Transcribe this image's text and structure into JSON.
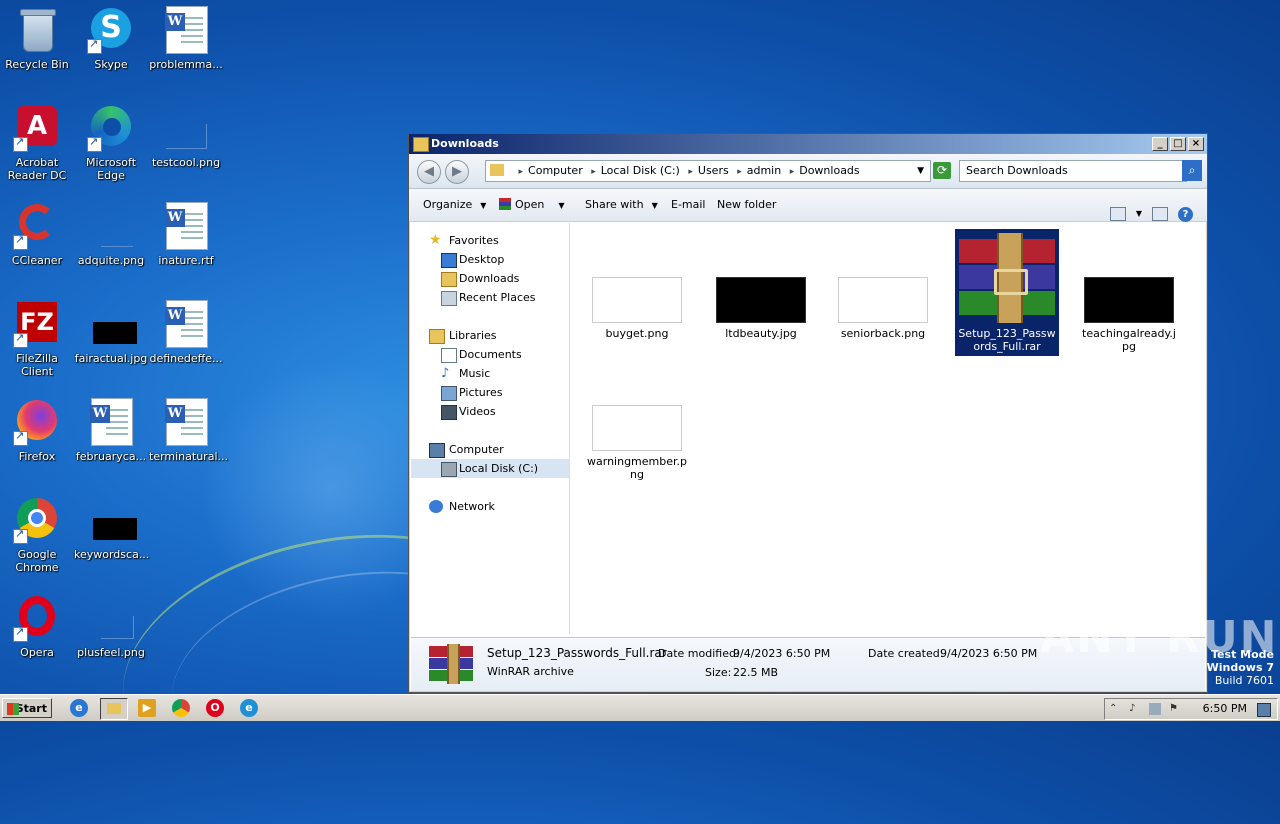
{
  "desktop": {
    "icons": [
      {
        "label": "Recycle Bin"
      },
      {
        "label": "Skype"
      },
      {
        "label": "problemma..."
      },
      {
        "label": "Acrobat Reader DC"
      },
      {
        "label": "Microsoft Edge"
      },
      {
        "label": "testcool.png"
      },
      {
        "label": "CCleaner"
      },
      {
        "label": "adquite.png"
      },
      {
        "label": "inature.rtf"
      },
      {
        "label": "FileZilla Client"
      },
      {
        "label": "fairactual.jpg"
      },
      {
        "label": "definedeffe..."
      },
      {
        "label": "Firefox"
      },
      {
        "label": "februaryca..."
      },
      {
        "label": "terminatural..."
      },
      {
        "label": "Google Chrome"
      },
      {
        "label": "keywordsca..."
      },
      {
        "label": "Opera"
      },
      {
        "label": "plusfeel.png"
      }
    ]
  },
  "window": {
    "title": "Downloads",
    "breadcrumb": [
      "Computer",
      "Local Disk (C:)",
      "Users",
      "admin",
      "Downloads"
    ],
    "search_placeholder": "Search Downloads",
    "toolbar": {
      "organize": "Organize",
      "open": "Open",
      "share": "Share with",
      "email": "E-mail",
      "new_folder": "New folder"
    },
    "nav": {
      "favorites": "Favorites",
      "desktop": "Desktop",
      "downloads": "Downloads",
      "recent": "Recent Places",
      "libraries": "Libraries",
      "documents": "Documents",
      "music": "Music",
      "pictures": "Pictures",
      "videos": "Videos",
      "computer": "Computer",
      "localdisk": "Local Disk (C:)",
      "network": "Network"
    },
    "files": [
      {
        "name": "buyget.png"
      },
      {
        "name": "ltdbeauty.jpg"
      },
      {
        "name": "seniorback.png"
      },
      {
        "name": "Setup_123_Passwords_Full.rar"
      },
      {
        "name": "teachingalready.jpg"
      },
      {
        "name": "warningmember.png"
      }
    ],
    "details": {
      "name": "Setup_123_Passwords_Full.rar",
      "type": "WinRAR archive",
      "modified_label": "Date modified:",
      "modified": "9/4/2023 6:50 PM",
      "size_label": "Size:",
      "size": "22.5 MB",
      "created_label": "Date created:",
      "created": "9/4/2023 6:50 PM"
    }
  },
  "taskbar": {
    "start": "Start",
    "clock": "6:50 PM"
  },
  "watermark": "ANY RUN",
  "testmode": {
    "line1": "Test Mode",
    "line2": "Windows 7",
    "line3": "Build 7601"
  },
  "colors": {
    "title_gradient_start": "#0a246a",
    "selection": "#0a246a",
    "desktop": "#1a6cc9"
  }
}
